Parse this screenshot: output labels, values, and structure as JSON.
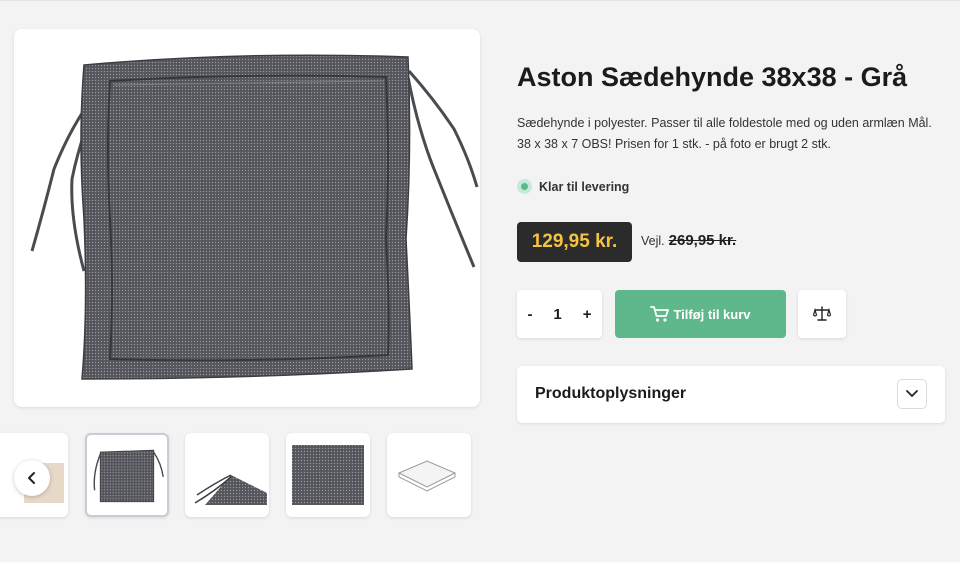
{
  "product": {
    "title": "Aston Sædehynde 38x38 - Grå",
    "description": "Sædehynde i polyester. Passer til alle foldestole med og uden armlæn Mål. 38 x 38 x 7 OBS! Prisen for 1 stk. - på foto er brugt 2 stk.",
    "stock_status": "Klar til levering",
    "price": "129,95 kr.",
    "rrp_label": "Vejl.",
    "rrp_price": "269,95 kr."
  },
  "purchase": {
    "minus_label": "-",
    "quantity": "1",
    "plus_label": "+",
    "add_to_cart_label": "Tilføj til kurv"
  },
  "accordion": {
    "title": "Produktoplysninger"
  },
  "gallery": {
    "thumbnails": [
      "cushion-front",
      "cushion-corner-ties",
      "fabric-closeup",
      "dimension-drawing"
    ],
    "active_index": 0
  },
  "colors": {
    "page_bg": "#f3f3f4",
    "price_bg": "#2b2b2b",
    "price_text": "#f5c242",
    "cart_button": "#5fb88b",
    "stock_dot": "#58b98a",
    "cushion": "#5a5b61"
  },
  "icons": {
    "carousel_prev": "chevron-left-icon",
    "cart": "cart-icon",
    "compare": "scale-icon",
    "accordion_toggle": "chevron-down-icon",
    "stock": "status-dot-icon"
  }
}
